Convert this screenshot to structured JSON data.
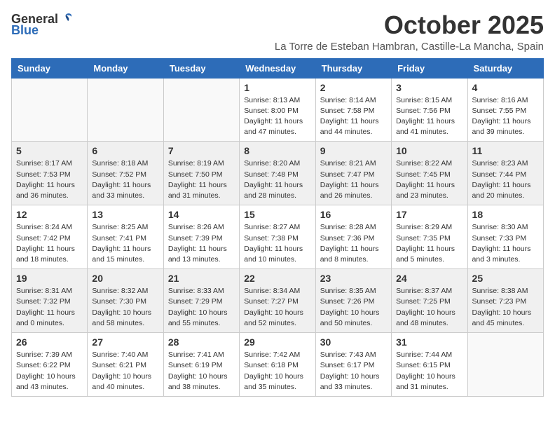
{
  "logo": {
    "general": "General",
    "blue": "Blue"
  },
  "title": "October 2025",
  "location": "La Torre de Esteban Hambran, Castille-La Mancha, Spain",
  "headers": [
    "Sunday",
    "Monday",
    "Tuesday",
    "Wednesday",
    "Thursday",
    "Friday",
    "Saturday"
  ],
  "weeks": [
    [
      {
        "day": "",
        "info": ""
      },
      {
        "day": "",
        "info": ""
      },
      {
        "day": "",
        "info": ""
      },
      {
        "day": "1",
        "info": "Sunrise: 8:13 AM\nSunset: 8:00 PM\nDaylight: 11 hours and 47 minutes."
      },
      {
        "day": "2",
        "info": "Sunrise: 8:14 AM\nSunset: 7:58 PM\nDaylight: 11 hours and 44 minutes."
      },
      {
        "day": "3",
        "info": "Sunrise: 8:15 AM\nSunset: 7:56 PM\nDaylight: 11 hours and 41 minutes."
      },
      {
        "day": "4",
        "info": "Sunrise: 8:16 AM\nSunset: 7:55 PM\nDaylight: 11 hours and 39 minutes."
      }
    ],
    [
      {
        "day": "5",
        "info": "Sunrise: 8:17 AM\nSunset: 7:53 PM\nDaylight: 11 hours and 36 minutes."
      },
      {
        "day": "6",
        "info": "Sunrise: 8:18 AM\nSunset: 7:52 PM\nDaylight: 11 hours and 33 minutes."
      },
      {
        "day": "7",
        "info": "Sunrise: 8:19 AM\nSunset: 7:50 PM\nDaylight: 11 hours and 31 minutes."
      },
      {
        "day": "8",
        "info": "Sunrise: 8:20 AM\nSunset: 7:48 PM\nDaylight: 11 hours and 28 minutes."
      },
      {
        "day": "9",
        "info": "Sunrise: 8:21 AM\nSunset: 7:47 PM\nDaylight: 11 hours and 26 minutes."
      },
      {
        "day": "10",
        "info": "Sunrise: 8:22 AM\nSunset: 7:45 PM\nDaylight: 11 hours and 23 minutes."
      },
      {
        "day": "11",
        "info": "Sunrise: 8:23 AM\nSunset: 7:44 PM\nDaylight: 11 hours and 20 minutes."
      }
    ],
    [
      {
        "day": "12",
        "info": "Sunrise: 8:24 AM\nSunset: 7:42 PM\nDaylight: 11 hours and 18 minutes."
      },
      {
        "day": "13",
        "info": "Sunrise: 8:25 AM\nSunset: 7:41 PM\nDaylight: 11 hours and 15 minutes."
      },
      {
        "day": "14",
        "info": "Sunrise: 8:26 AM\nSunset: 7:39 PM\nDaylight: 11 hours and 13 minutes."
      },
      {
        "day": "15",
        "info": "Sunrise: 8:27 AM\nSunset: 7:38 PM\nDaylight: 11 hours and 10 minutes."
      },
      {
        "day": "16",
        "info": "Sunrise: 8:28 AM\nSunset: 7:36 PM\nDaylight: 11 hours and 8 minutes."
      },
      {
        "day": "17",
        "info": "Sunrise: 8:29 AM\nSunset: 7:35 PM\nDaylight: 11 hours and 5 minutes."
      },
      {
        "day": "18",
        "info": "Sunrise: 8:30 AM\nSunset: 7:33 PM\nDaylight: 11 hours and 3 minutes."
      }
    ],
    [
      {
        "day": "19",
        "info": "Sunrise: 8:31 AM\nSunset: 7:32 PM\nDaylight: 11 hours and 0 minutes."
      },
      {
        "day": "20",
        "info": "Sunrise: 8:32 AM\nSunset: 7:30 PM\nDaylight: 10 hours and 58 minutes."
      },
      {
        "day": "21",
        "info": "Sunrise: 8:33 AM\nSunset: 7:29 PM\nDaylight: 10 hours and 55 minutes."
      },
      {
        "day": "22",
        "info": "Sunrise: 8:34 AM\nSunset: 7:27 PM\nDaylight: 10 hours and 52 minutes."
      },
      {
        "day": "23",
        "info": "Sunrise: 8:35 AM\nSunset: 7:26 PM\nDaylight: 10 hours and 50 minutes."
      },
      {
        "day": "24",
        "info": "Sunrise: 8:37 AM\nSunset: 7:25 PM\nDaylight: 10 hours and 48 minutes."
      },
      {
        "day": "25",
        "info": "Sunrise: 8:38 AM\nSunset: 7:23 PM\nDaylight: 10 hours and 45 minutes."
      }
    ],
    [
      {
        "day": "26",
        "info": "Sunrise: 7:39 AM\nSunset: 6:22 PM\nDaylight: 10 hours and 43 minutes."
      },
      {
        "day": "27",
        "info": "Sunrise: 7:40 AM\nSunset: 6:21 PM\nDaylight: 10 hours and 40 minutes."
      },
      {
        "day": "28",
        "info": "Sunrise: 7:41 AM\nSunset: 6:19 PM\nDaylight: 10 hours and 38 minutes."
      },
      {
        "day": "29",
        "info": "Sunrise: 7:42 AM\nSunset: 6:18 PM\nDaylight: 10 hours and 35 minutes."
      },
      {
        "day": "30",
        "info": "Sunrise: 7:43 AM\nSunset: 6:17 PM\nDaylight: 10 hours and 33 minutes."
      },
      {
        "day": "31",
        "info": "Sunrise: 7:44 AM\nSunset: 6:15 PM\nDaylight: 10 hours and 31 minutes."
      },
      {
        "day": "",
        "info": ""
      }
    ]
  ]
}
